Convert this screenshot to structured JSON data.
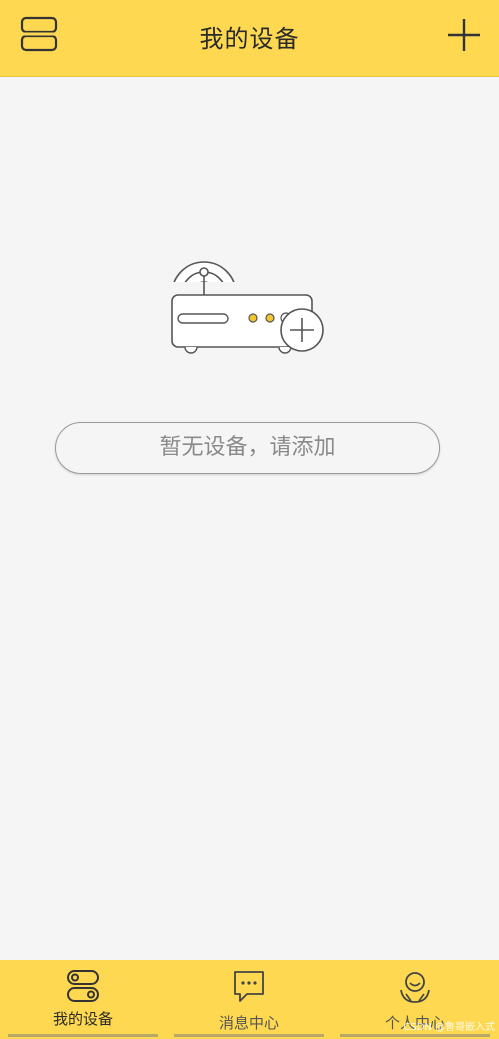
{
  "header": {
    "title": "我的设备",
    "menu_icon": "menu-icon",
    "add_icon": "plus-icon"
  },
  "empty_state": {
    "illustration": "router-add-icon",
    "add_button_label": "暂无设备，请添加"
  },
  "tabbar": {
    "tabs": [
      {
        "label": "我的设备",
        "icon": "device-icon",
        "active": true
      },
      {
        "label": "消息中心",
        "icon": "message-icon",
        "active": false
      },
      {
        "label": "个人中心",
        "icon": "person-icon",
        "active": false
      }
    ]
  },
  "watermark": "CSDN @鲁哥嵌入式",
  "colors": {
    "accent": "#fdd850",
    "background": "#f5f5f5",
    "device_led": "#f2c62f"
  }
}
